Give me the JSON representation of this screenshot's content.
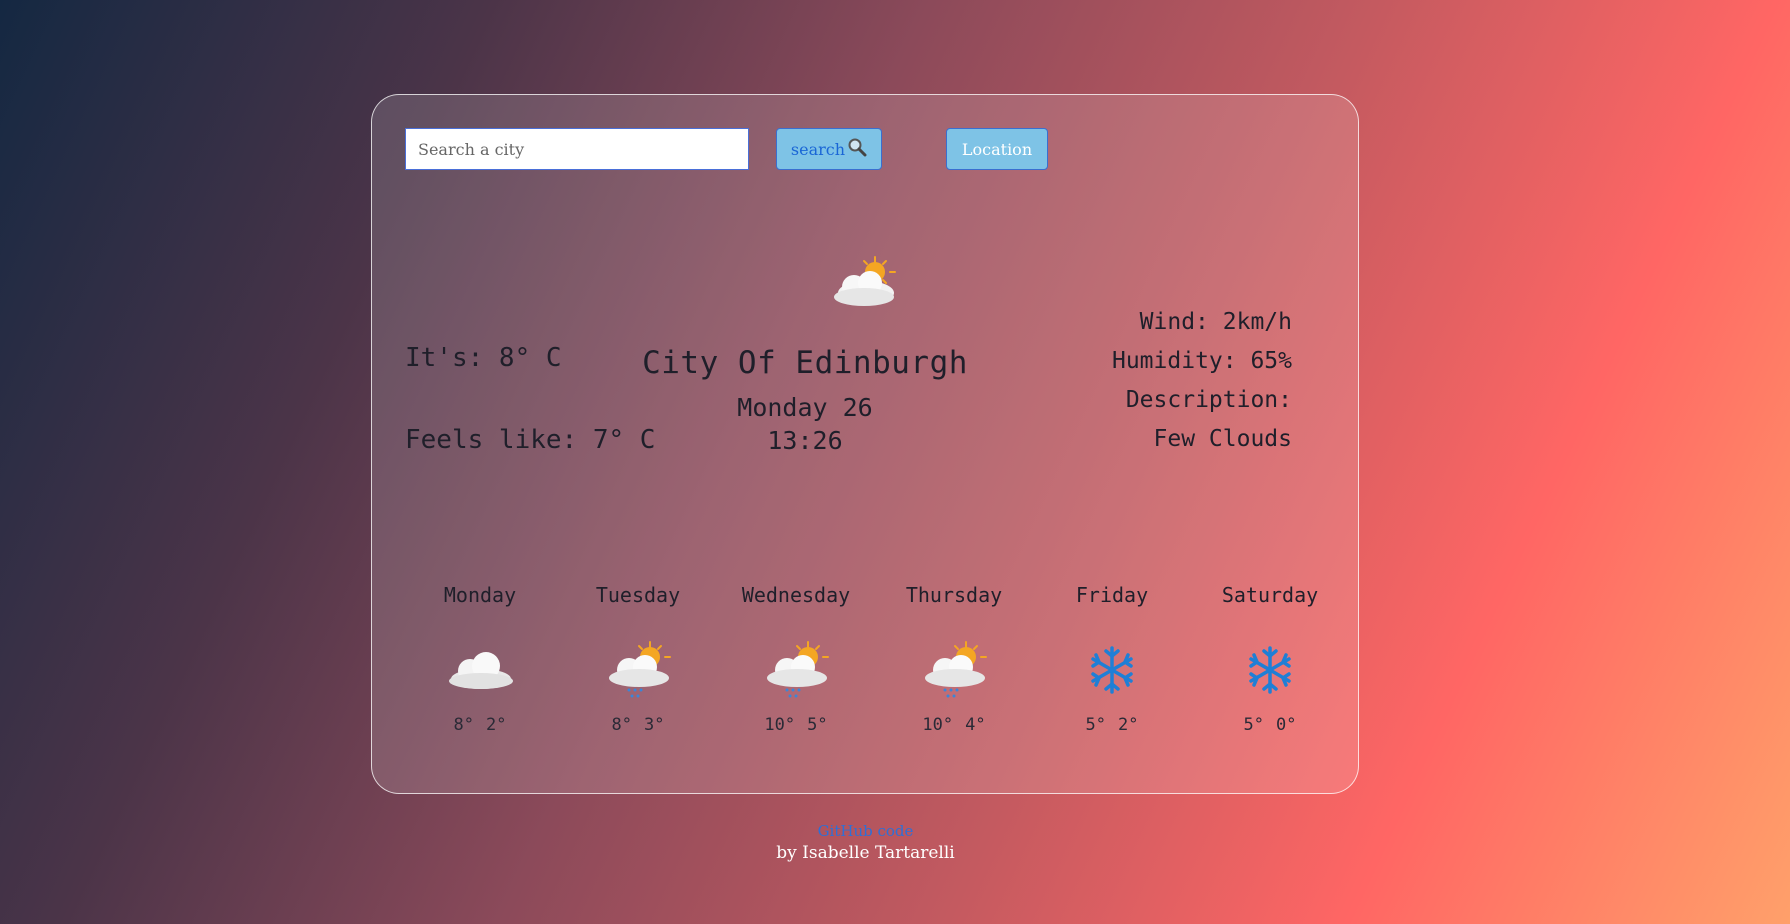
{
  "search": {
    "placeholder": "Search a city",
    "button_label": "search",
    "location_label": "Location"
  },
  "current": {
    "icon": "partly-cloudy-icon",
    "city": "City Of Edinburgh",
    "date": "Monday 26",
    "time": "13:26",
    "temp": "It's: 8° C",
    "feels_like": "Feels like: 7° C",
    "wind": "Wind: 2km/h",
    "humidity": "Humidity: 65%",
    "description_label": "Description:",
    "description": "Few Clouds"
  },
  "forecast": [
    {
      "day": "Monday",
      "icon": "cloud-icon",
      "max": "8°",
      "min": "2°"
    },
    {
      "day": "Tuesday",
      "icon": "partly-cloudy-rain-icon",
      "max": "8°",
      "min": "3°"
    },
    {
      "day": "Wednesday",
      "icon": "partly-cloudy-rain-icon",
      "max": "10°",
      "min": "5°"
    },
    {
      "day": "Thursday",
      "icon": "partly-cloudy-rain-icon",
      "max": "10°",
      "min": "4°"
    },
    {
      "day": "Friday",
      "icon": "snowflake-icon",
      "max": "5°",
      "min": "2°"
    },
    {
      "day": "Saturday",
      "icon": "snowflake-icon",
      "max": "5°",
      "min": "0°"
    }
  ],
  "footer": {
    "link_text": "GitHub code",
    "credit": "by Isabelle Tartarelli"
  },
  "colors": {
    "button_bg": "#7ec3e6",
    "link": "#2e6fd6",
    "sun": "#f4a623",
    "snow": "#1f7fd6"
  }
}
